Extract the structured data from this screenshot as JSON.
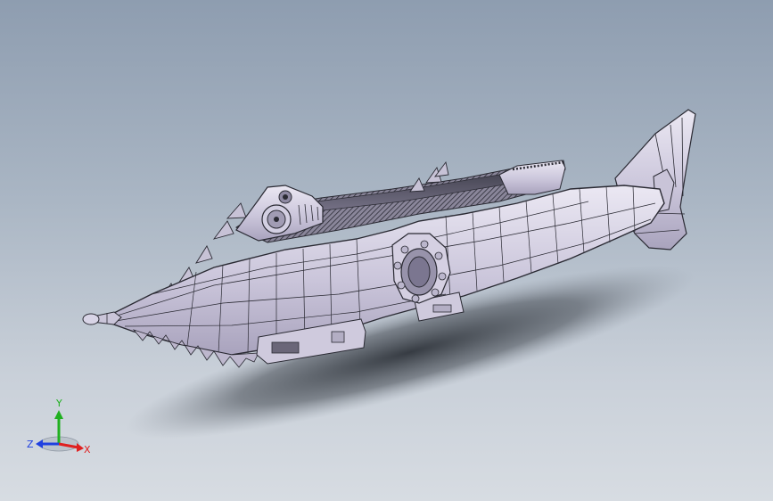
{
  "viewport": {
    "background_top": "#8e9db0",
    "background_bottom": "#d7dce2"
  },
  "model": {
    "body_color": "#d6d2e4",
    "edge_color": "#2a2a33",
    "shadow_color": "#3a3f47"
  },
  "triad": {
    "x_label": "X",
    "y_label": "Y",
    "z_label": "Z",
    "x_color": "#e02020",
    "y_color": "#20b020",
    "z_color": "#2040e0"
  }
}
